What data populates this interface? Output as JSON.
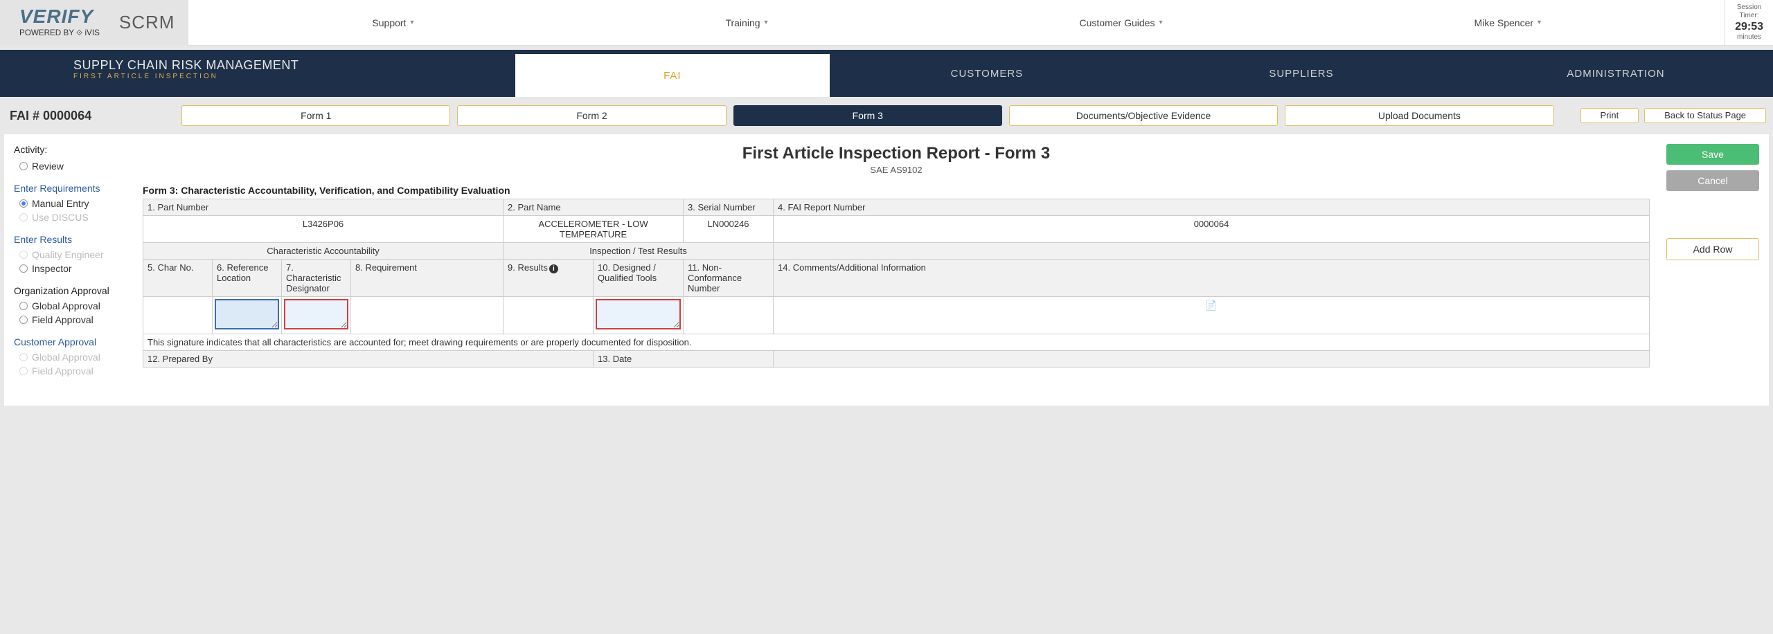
{
  "logo": {
    "main": "VERIFY",
    "sub": "POWERED BY ⟐ iVIS",
    "scrm": "SCRM"
  },
  "topnav": {
    "support": "Support",
    "training": "Training",
    "guides": "Customer Guides",
    "user": "Mike Spencer"
  },
  "session": {
    "label1": "Session",
    "label2": "Timer:",
    "time": "29:53",
    "units": "minutes"
  },
  "mainnav": {
    "title": "SUPPLY CHAIN RISK MANAGEMENT",
    "subtitle": "FIRST ARTICLE INSPECTION",
    "tabs": {
      "fai": "FAI",
      "customers": "CUSTOMERS",
      "suppliers": "SUPPLIERS",
      "admin": "ADMINISTRATION"
    }
  },
  "toolbar": {
    "fai_num": "FAI # 0000064",
    "form1": "Form 1",
    "form2": "Form 2",
    "form3": "Form 3",
    "docs": "Documents/Objective Evidence",
    "upload": "Upload Documents",
    "print": "Print",
    "back": "Back to Status Page"
  },
  "sidebar": {
    "activity": "Activity:",
    "review": "Review",
    "enter_req": "Enter Requirements",
    "manual": "Manual Entry",
    "discus": "Use DISCUS",
    "enter_res": "Enter Results",
    "qe": "Quality Engineer",
    "inspector": "Inspector",
    "org_app": "Organization Approval",
    "global_app": "Global Approval",
    "field_app": "Field Approval",
    "cust_app": "Customer Approval",
    "global_app2": "Global Approval",
    "field_app2": "Field Approval"
  },
  "page": {
    "title": "First Article Inspection Report - Form 3",
    "sub": "SAE AS9102",
    "form_label": "Form 3: Characteristic Accountability, Verification, and Compatibility Evaluation"
  },
  "table": {
    "h_part_num": "1. Part Number",
    "h_part_name": "2. Part Name",
    "h_serial": "3. Serial Number",
    "h_fai": "4. FAI Report Number",
    "v_part_num": "L3426P06",
    "v_part_name": "ACCELEROMETER - LOW TEMPERATURE",
    "v_serial": "LN000246",
    "v_fai": "0000064",
    "h_char_acc": "Characteristic Accountability",
    "h_insp": "Inspection / Test Results",
    "h5": "5. Char No.",
    "h6": "6. Reference Location",
    "h7": "7. Characteristic Designator",
    "h8": "8. Requirement",
    "h9": "9. Results",
    "h10": "10. Designed / Qualified Tools",
    "h11": "11. Non-Conformance Number",
    "h14": "14. Comments/Additional Information",
    "sig": "This signature indicates that all characteristics are accounted for; meet drawing requirements or are properly documented for disposition.",
    "h12": "12. Prepared By",
    "h13": "13. Date"
  },
  "buttons": {
    "save": "Save",
    "cancel": "Cancel",
    "addrow": "Add Row"
  }
}
